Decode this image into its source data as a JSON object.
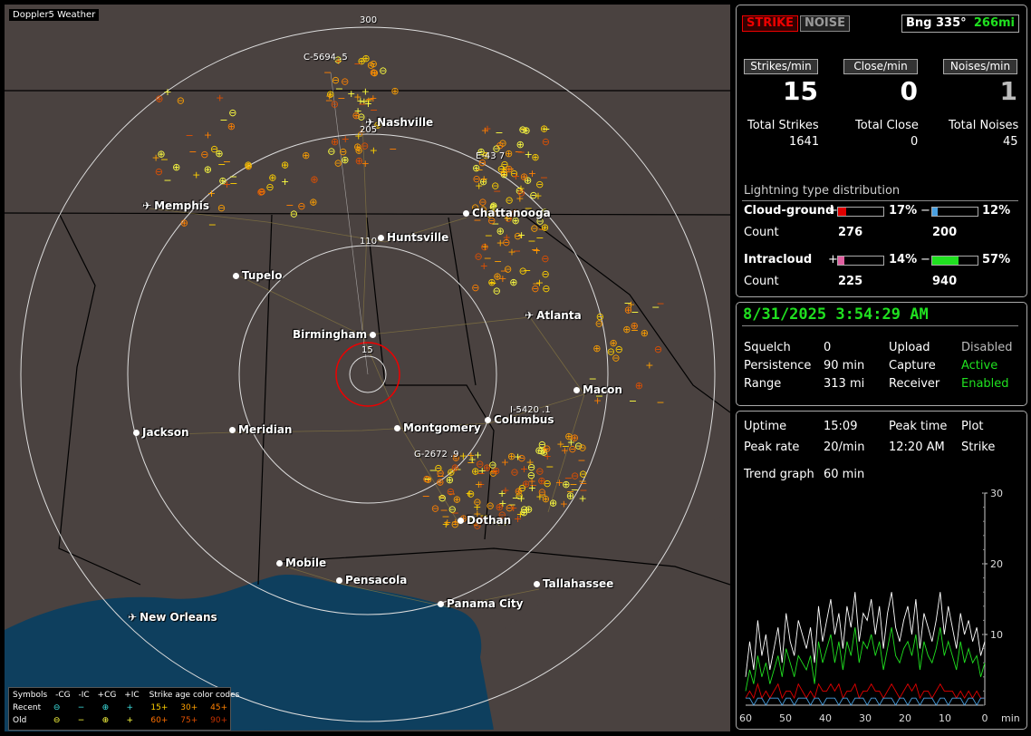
{
  "map": {
    "title": "Doppler5 Weather",
    "cities": [
      {
        "name": "Nashville",
        "type": "plane"
      },
      {
        "name": "Memphis",
        "type": "plane"
      },
      {
        "name": "Chattanooga",
        "type": "dot"
      },
      {
        "name": "Huntsville",
        "type": "dot"
      },
      {
        "name": "Tupelo",
        "type": "dot"
      },
      {
        "name": "Atlanta",
        "type": "plane"
      },
      {
        "name": "Birmingham",
        "type": "dot"
      },
      {
        "name": "Macon",
        "type": "dot"
      },
      {
        "name": "Jackson",
        "type": "dot"
      },
      {
        "name": "Meridian",
        "type": "dot"
      },
      {
        "name": "Montgomery",
        "type": "dot"
      },
      {
        "name": "Columbus",
        "type": "dot"
      },
      {
        "name": "Dothan",
        "type": "dot"
      },
      {
        "name": "Mobile",
        "type": "dot"
      },
      {
        "name": "Pensacola",
        "type": "dot"
      },
      {
        "name": "Tallahassee",
        "type": "dot"
      },
      {
        "name": "Panama City",
        "type": "dot"
      },
      {
        "name": "New Orleans",
        "type": "plane"
      }
    ],
    "range_labels": [
      "300",
      "205",
      "110",
      "15"
    ],
    "cell_labels": [
      "C-5694 .5",
      "E-43 7",
      "I-5420 .1",
      "G-2672 .9"
    ]
  },
  "legend": {
    "symbols_label": "Symbols",
    "col_ncg": "-CG",
    "col_nic": "-IC",
    "col_pcg": "+CG",
    "col_pic": "+IC",
    "age_title": "Strike age color codes",
    "recent_label": "Recent",
    "old_label": "Old",
    "recent_ages": [
      "15+",
      "30+",
      "45+"
    ],
    "old_ages": [
      "60+",
      "75+",
      "90+"
    ]
  },
  "header": {
    "strike_label": "STRIKE",
    "noise_label": "NOISE",
    "bearing": "Bng 335°",
    "distance": "266mi"
  },
  "rates": {
    "strikes_label": "Strikes/min",
    "close_label": "Close/min",
    "noises_label": "Noises/min",
    "strikes": "15",
    "close": "0",
    "noises": "1",
    "total_strikes_label": "Total Strikes",
    "total_close_label": "Total Close",
    "total_noises_label": "Total Noises",
    "total_strikes": "1641",
    "total_close": "0",
    "total_noises": "45"
  },
  "distribution": {
    "title": "Lightning type distribution",
    "cg_label": "Cloud-ground",
    "ic_label": "Intracloud",
    "count_label": "Count",
    "plus": "+",
    "minus": "−",
    "cg_pos_pct": "17%",
    "cg_neg_pct": "12%",
    "ic_pos_pct": "14%",
    "ic_neg_pct": "57%",
    "cg_pos_fraction": 0.17,
    "cg_neg_fraction": 0.12,
    "ic_pos_fraction": 0.14,
    "ic_neg_fraction": 0.57,
    "cg_pos_count": "276",
    "cg_neg_count": "200",
    "ic_pos_count": "225",
    "ic_neg_count": "940",
    "colors": {
      "cg_pos": "#e00000",
      "cg_neg": "#4aa0e0",
      "ic_pos": "#e060a0",
      "ic_neg": "#20e020"
    }
  },
  "status": {
    "datetime": "8/31/2025 3:54:29 AM",
    "squelch_label": "Squelch",
    "squelch": "0",
    "persistence_label": "Persistence",
    "persistence": "90 min",
    "range_label": "Range",
    "range": "313 mi",
    "upload_label": "Upload",
    "upload": "Disabled",
    "capture_label": "Capture",
    "capture": "Active",
    "receiver_label": "Receiver",
    "receiver": "Enabled"
  },
  "trend": {
    "uptime_label": "Uptime",
    "uptime": "15:09",
    "peak_time_label": "Peak time",
    "peak_time": "12:20 AM",
    "plot_label": "Plot",
    "plot": "Strike",
    "peak_rate_label": "Peak rate",
    "peak_rate": "20/min",
    "trend_label": "Trend graph",
    "trend_window": "60 min",
    "x_ticks": [
      "60",
      "50",
      "40",
      "30",
      "20",
      "10",
      "0"
    ],
    "x_unit": "min",
    "y_ticks": [
      "30",
      "20",
      "10"
    ]
  },
  "chart_data": {
    "type": "line",
    "xlabel": "min",
    "ylabel": "",
    "xlim": [
      60,
      0
    ],
    "ylim": [
      0,
      30
    ],
    "series": [
      {
        "color": "#ffffff",
        "values": [
          4,
          9,
          5,
          12,
          7,
          10,
          5,
          8,
          11,
          6,
          13,
          9,
          7,
          12,
          10,
          8,
          11,
          6,
          14,
          9,
          12,
          15,
          10,
          13,
          8,
          14,
          11,
          16,
          9,
          13,
          12,
          15,
          10,
          14,
          8,
          13,
          16,
          11,
          9,
          12,
          14,
          10,
          15,
          8,
          13,
          11,
          9,
          12,
          16,
          10,
          14,
          11,
          8,
          13,
          10,
          12,
          9,
          11,
          7,
          9
        ]
      },
      {
        "color": "#20e020",
        "values": [
          2,
          5,
          3,
          7,
          4,
          6,
          3,
          5,
          7,
          4,
          8,
          6,
          4,
          7,
          6,
          5,
          7,
          3,
          9,
          6,
          8,
          10,
          6,
          9,
          5,
          9,
          7,
          11,
          6,
          9,
          8,
          10,
          7,
          9,
          5,
          8,
          11,
          7,
          6,
          8,
          9,
          7,
          10,
          5,
          9,
          7,
          6,
          8,
          11,
          7,
          9,
          7,
          5,
          9,
          6,
          8,
          6,
          7,
          4,
          6
        ]
      },
      {
        "color": "#e00000",
        "values": [
          1,
          2,
          1,
          3,
          1,
          2,
          1,
          2,
          3,
          1,
          2,
          2,
          1,
          3,
          2,
          1,
          2,
          1,
          3,
          2,
          2,
          3,
          2,
          3,
          1,
          2,
          2,
          3,
          1,
          2,
          2,
          3,
          2,
          2,
          1,
          2,
          3,
          2,
          1,
          2,
          3,
          2,
          3,
          1,
          2,
          2,
          1,
          2,
          3,
          2,
          2,
          2,
          1,
          2,
          1,
          2,
          1,
          2,
          1,
          1
        ]
      },
      {
        "color": "#4aa0e0",
        "values": [
          1,
          1,
          0,
          1,
          1,
          0,
          1,
          1,
          1,
          0,
          1,
          1,
          0,
          1,
          1,
          1,
          0,
          1,
          1,
          0,
          1,
          1,
          1,
          0,
          1,
          1,
          0,
          1,
          1,
          1,
          0,
          1,
          1,
          0,
          1,
          1,
          1,
          0,
          1,
          1,
          0,
          1,
          1,
          0,
          1,
          1,
          1,
          0,
          1,
          1,
          0,
          1,
          1,
          1,
          0,
          1,
          1,
          0,
          1,
          1
        ]
      }
    ]
  }
}
